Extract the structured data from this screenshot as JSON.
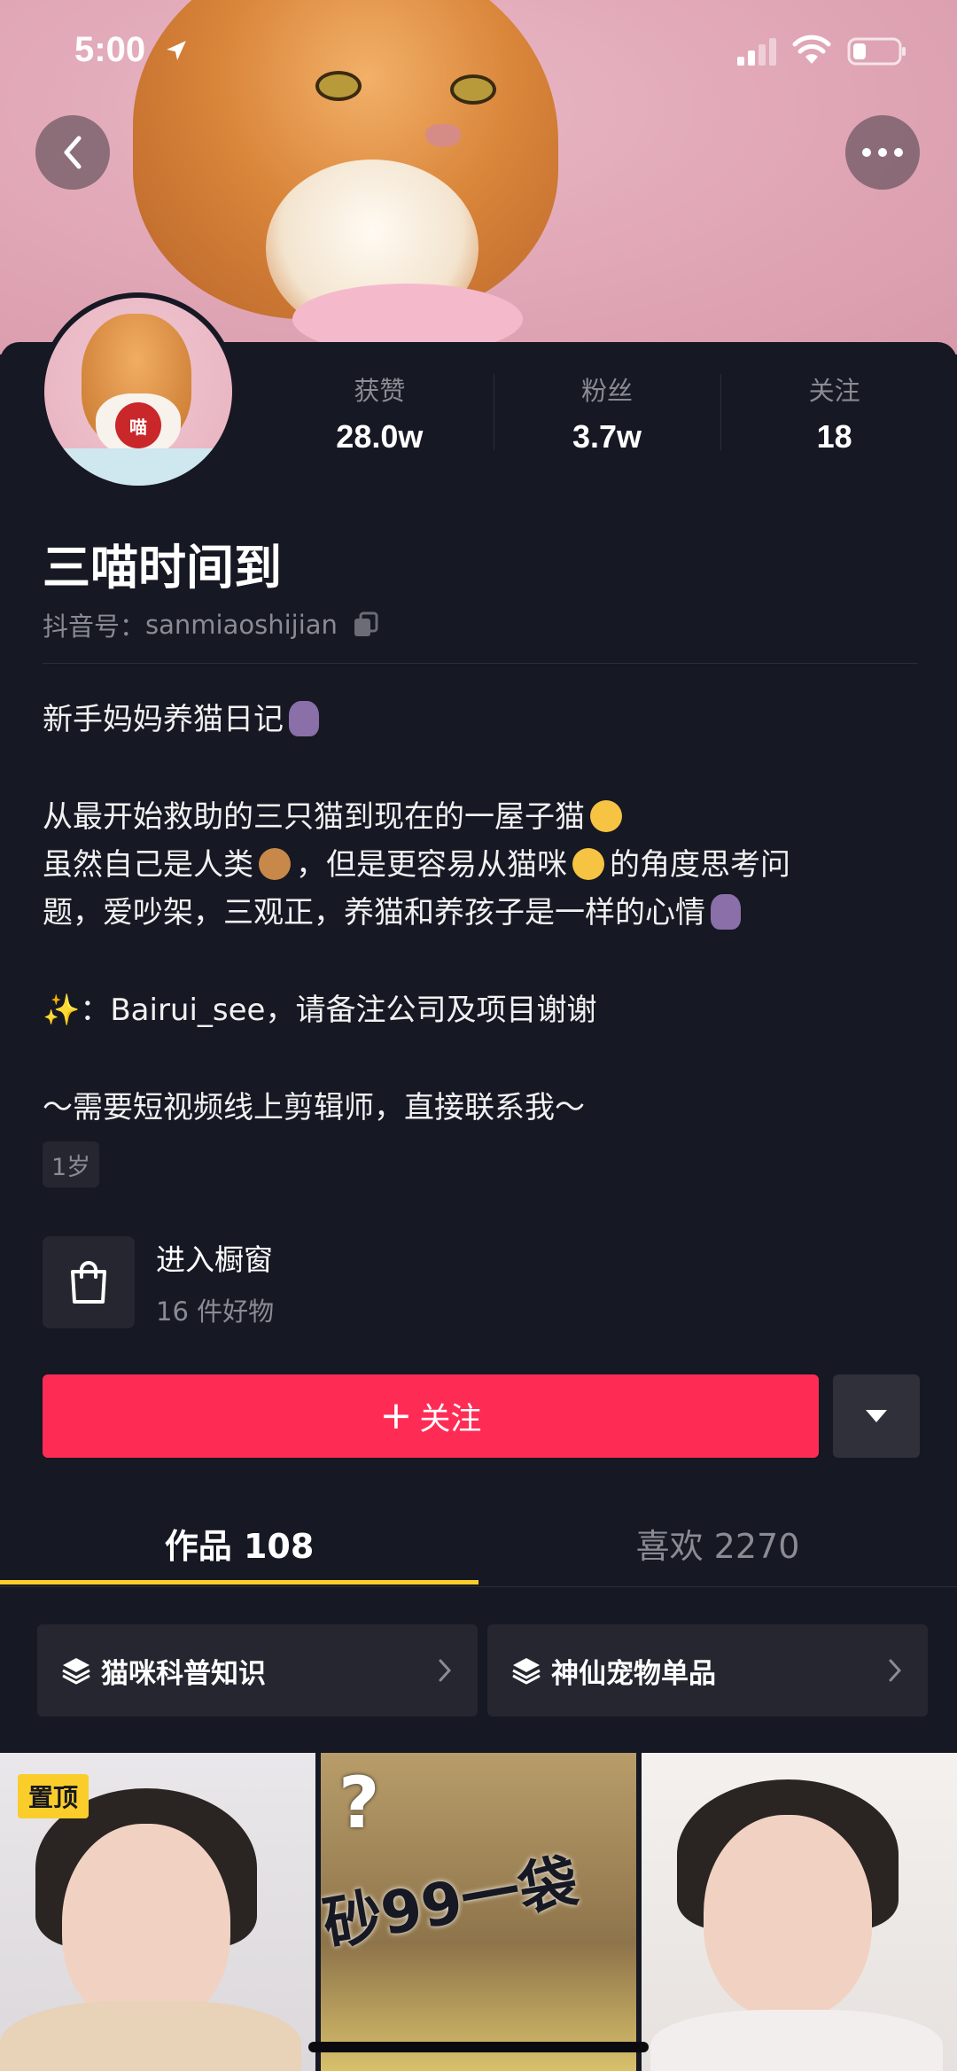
{
  "status_bar": {
    "time": "5:00"
  },
  "profile": {
    "name": "三喵时间到",
    "handle_label": "抖音号：",
    "handle": "sanmiaoshijian",
    "avatar_badge": "喵"
  },
  "stats": [
    {
      "label": "获赞",
      "value": "28.0w"
    },
    {
      "label": "粉丝",
      "value": "3.7w"
    },
    {
      "label": "关注",
      "value": "18"
    }
  ],
  "bio": {
    "line1": "新手妈妈养猫日记",
    "line2": "从最开始救助的三只猫到现在的一屋子猫",
    "line3a": "虽然自己是人类",
    "line3b": "，但是更容易从猫咪",
    "line3c": "的角度思考问",
    "line4": "题，爱吵架，三观正，养猫和养孩子是一样的心情",
    "line5_sparkle": "✨",
    "line5": "：Bairui_see，请备注公司及项目谢谢",
    "line6": "～需要短视频线上剪辑师，直接联系我～"
  },
  "age_tag": "1岁",
  "shop": {
    "title": "进入橱窗",
    "subtitle": "16 件好物"
  },
  "actions": {
    "follow_plus": "+",
    "follow_label": "关注"
  },
  "tabs": [
    {
      "label": "作品 108",
      "active": true
    },
    {
      "label": "喜欢 2270",
      "active": false
    }
  ],
  "collections": [
    {
      "label": "猫咪科普知识"
    },
    {
      "label": "神仙宠物单品"
    }
  ],
  "videos": {
    "pinned_label": "置顶",
    "thumb2_text": "砂99一袋",
    "thumb2_mark": "?"
  },
  "colors": {
    "accent": "#fe2c55",
    "tab_underline": "#facd2a",
    "background": "#161823"
  }
}
